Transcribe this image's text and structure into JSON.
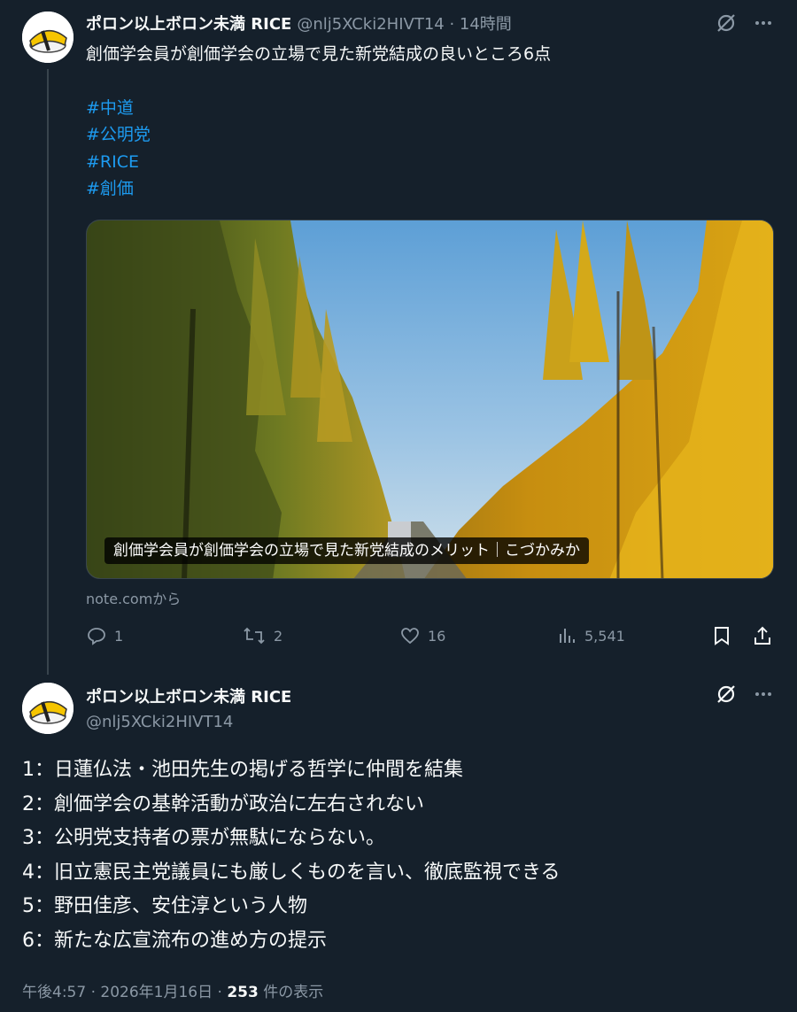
{
  "thread_post": {
    "author_name": "ポロン以上ボロン未満 RICE",
    "handle_time": "@nlj5XCki2HIVT14 · 14時間",
    "title": "創価学会員が創価学会の立場で見た新党結成の良いところ6点",
    "hashtags": [
      "#中道",
      "#公明党",
      "#RICE",
      "#創価"
    ],
    "card_caption": "創価学会員が創価学会の立場で見た新党結成のメリット｜こづかみか",
    "card_source": "note.comから",
    "stats": {
      "replies": "1",
      "reposts": "2",
      "likes": "16",
      "views": "5,541"
    }
  },
  "main_post": {
    "author_name": "ポロン以上ボロン未満 RICE",
    "handle": "@nlj5XCki2HIVT14",
    "lines": [
      "1：日蓮仏法・池田先生の掲げる哲学に仲間を結集",
      "2：創価学会の基幹活動が政治に左右されない",
      "3：公明党支持者の票が無駄にならない。",
      "4：旧立憲民主党議員にも厳しくものを言い、徹底監視できる",
      "5：野田佳彦、安住淳という人物",
      "6：新たな広宣流布の進め方の提示"
    ],
    "timestamp": "午後4:57 · 2026年1月16日 ·",
    "view_count": "253",
    "view_label": "件の表示"
  },
  "colors": {
    "background": "#15202b",
    "text": "#f7f9f9",
    "muted": "#8b98a5",
    "link": "#1d9bf0",
    "line": "#38444d"
  },
  "icons": [
    "grok-icon",
    "more-icon",
    "reply-icon",
    "repost-icon",
    "like-icon",
    "views-icon",
    "bookmark-icon",
    "share-icon"
  ]
}
